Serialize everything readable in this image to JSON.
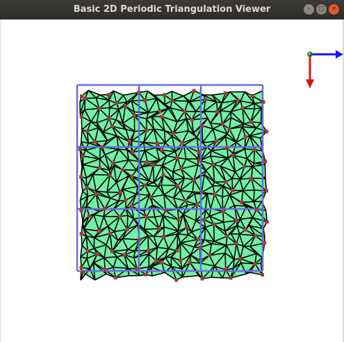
{
  "window": {
    "title": "Basic 2D Periodic Triangulation Viewer",
    "buttons": {
      "minimize": "–",
      "maximize": "□",
      "close": "×"
    }
  },
  "colors": {
    "titlebar": "#2e2d2a",
    "fill": "#72f0a4",
    "edges": "#000000",
    "vertices": "#a53a3a",
    "domain": "#6a6ae6",
    "axis_x": "#1010ff",
    "axis_y": "#e01010",
    "axis_origin": "#10a010"
  },
  "scene": {
    "domain_grid": "3x3",
    "axes_icon": [
      "x-axis-arrow",
      "y-axis-arrow",
      "origin-marker"
    ]
  }
}
